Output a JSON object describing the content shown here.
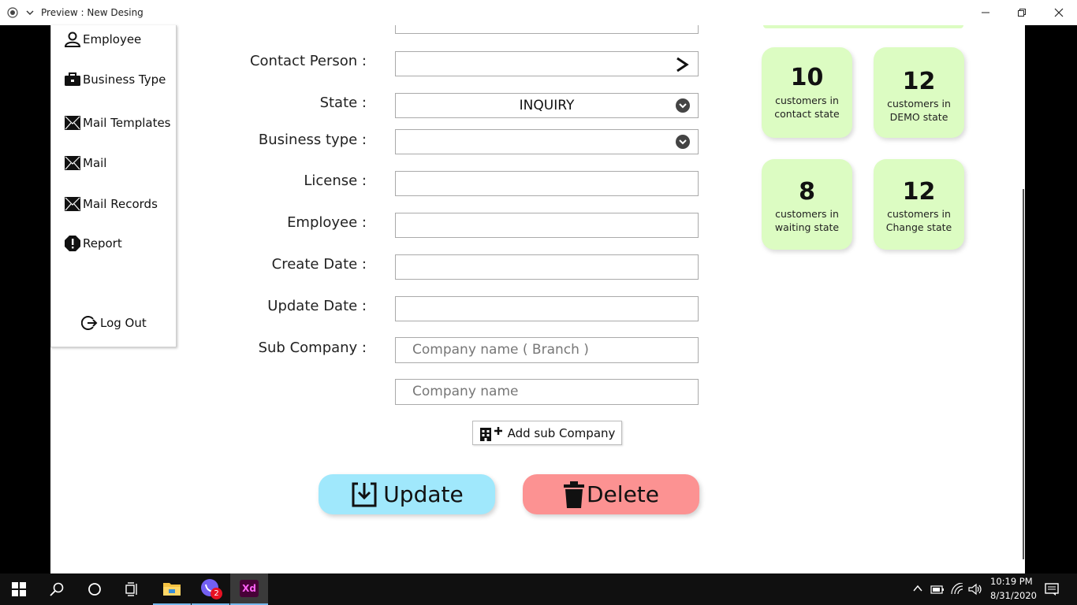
{
  "window": {
    "title": "Preview : New Desing"
  },
  "sidebar": {
    "items": [
      {
        "label": "Employee",
        "icon": "user-icon"
      },
      {
        "label": "Business Type",
        "icon": "briefcase-icon"
      },
      {
        "label": "Mail Templates",
        "icon": "mail-icon"
      },
      {
        "label": "Mail",
        "icon": "mail-icon"
      },
      {
        "label": "Mail Records",
        "icon": "mail-icon"
      },
      {
        "label": "Report",
        "icon": "alert-icon"
      }
    ],
    "logout": "Log Out"
  },
  "form": {
    "contact_person_label": "Contact Person :",
    "state_label": "State :",
    "state_value": "INQUIRY",
    "business_type_label": "Business type :",
    "license_label": "License :",
    "employee_label": "Employee :",
    "create_date_label": "Create Date :",
    "update_date_label": "Update Date :",
    "sub_company_label": "Sub Company :",
    "sub_company_branch_placeholder": "Company name ( Branch )",
    "sub_company_name_placeholder": "Company name",
    "add_sub_company": "Add sub Company",
    "update": "Update",
    "delete": "Delete"
  },
  "stats": [
    {
      "count": "10",
      "line1": "customers in",
      "line2": "contact state"
    },
    {
      "count": "12",
      "line1": "customers in",
      "line2": "DEMO state"
    },
    {
      "count": "8",
      "line1": "customers in",
      "line2": "waiting state"
    },
    {
      "count": "12",
      "line1": "customers in",
      "line2": "Change state"
    }
  ],
  "colors": {
    "card_bg": "#dcfcc2",
    "update_bg": "#a0e8fc",
    "delete_bg": "#fc9292",
    "xd_tile": "#470137"
  },
  "taskbar": {
    "time": "10:19 PM",
    "date": "8/31/2020",
    "viber_badge": "2",
    "xd_label": "Xd"
  }
}
